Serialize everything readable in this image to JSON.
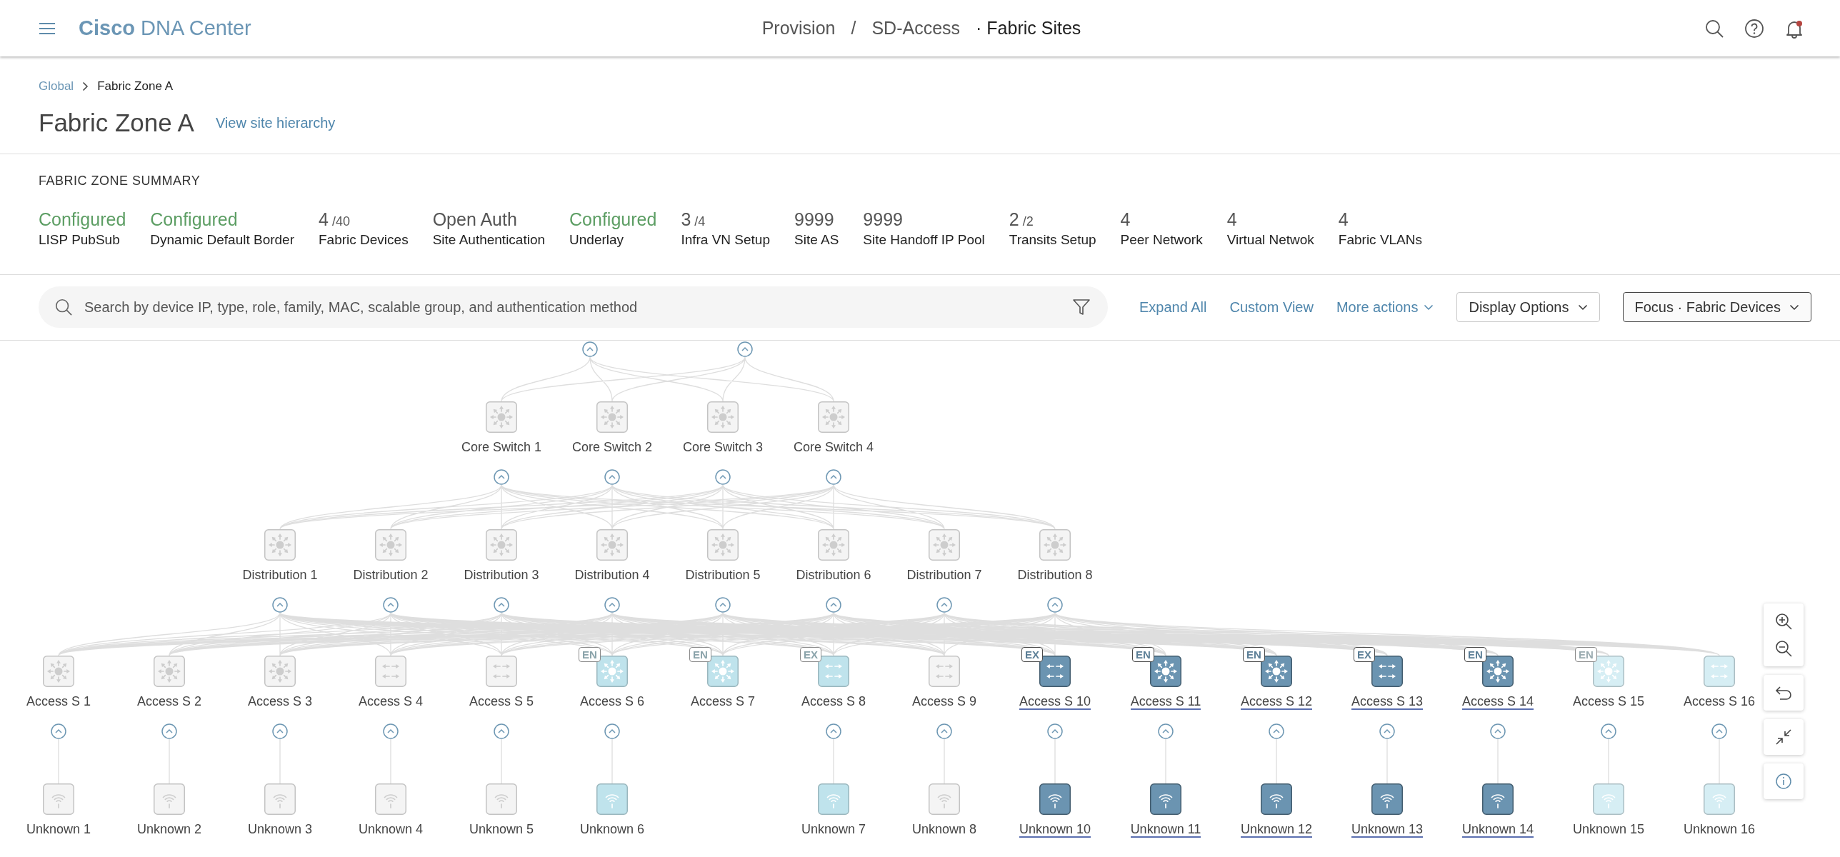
{
  "header": {
    "app_name": "**Cisco** DNA Center",
    "nav": [
      {
        "label": "Provision"
      },
      {
        "label": "SD-Access"
      }
    ],
    "nav_separator": "/",
    "current_page": "· Fabric Sites",
    "notification_dot": true
  },
  "breadcrumb": [
    {
      "label": "Global"
    },
    {
      "label": "Fabric Zone A"
    }
  ],
  "page_title": "Fabric Zone A",
  "hierarchy_link": "View site hierarchy",
  "summary": {
    "title": "FABRIC ZONE SUMMARY",
    "items": [
      {
        "kind": "status",
        "value": "Configured",
        "label": "LISP PubSub"
      },
      {
        "kind": "status",
        "value": "Configured",
        "label": "Dynamic Default Border"
      },
      {
        "kind": "count",
        "value": "4",
        "total": "/40",
        "label": "Fabric Devices"
      },
      {
        "kind": "count",
        "value": "Open Auth",
        "label": "Site Authentication"
      },
      {
        "kind": "status",
        "value": "Configured",
        "label": "Underlay"
      },
      {
        "kind": "count",
        "value": "3",
        "total": "/4",
        "label": "Infra VN Setup"
      },
      {
        "kind": "count",
        "value": "9999",
        "label": "Site AS"
      },
      {
        "kind": "count",
        "value": "9999",
        "label": "Site Handoff IP Pool"
      },
      {
        "kind": "count",
        "value": "2",
        "total": "/2",
        "label": "Transits Setup"
      },
      {
        "kind": "count",
        "value": "4",
        "label": "Peer Network"
      },
      {
        "kind": "count",
        "value": "4",
        "label": "Virtual Netwok"
      },
      {
        "kind": "count",
        "value": "4",
        "label": "Fabric VLANs"
      }
    ]
  },
  "toolbar": {
    "search_placeholder": "Search by device IP, type, role, family, MAC, scalable group, and authentication method",
    "links": [
      {
        "label": "Expand All",
        "dropdown": false
      },
      {
        "label": "Custom View",
        "dropdown": false
      },
      {
        "label": "More actions",
        "dropdown": true
      }
    ],
    "buttons": [
      {
        "label": "Display Options",
        "selected": false
      },
      {
        "label": "Focus · Fabric Devices",
        "selected": true
      }
    ]
  },
  "topology": {
    "upstream_toggles": [
      {
        "expanded": true
      },
      {
        "expanded": true
      }
    ],
    "tiers": [
      {
        "nodes": [
          {
            "label": "Core Switch 1",
            "kind": "multilayer",
            "color": "#f4f4f4",
            "selected": false,
            "expanded": true
          },
          {
            "label": "Core Switch 2",
            "kind": "multilayer",
            "color": "#f4f4f4",
            "selected": false,
            "expanded": true
          },
          {
            "label": "Core Switch 3",
            "kind": "multilayer",
            "color": "#f4f4f4",
            "selected": false,
            "expanded": true
          },
          {
            "label": "Core Switch 4",
            "kind": "multilayer",
            "color": "#f4f4f4",
            "selected": false,
            "expanded": true
          }
        ]
      },
      {
        "nodes": [
          {
            "label": "Distribution 1",
            "kind": "multilayer",
            "color": "#f4f4f4",
            "selected": false,
            "expanded": true
          },
          {
            "label": "Distribution 2",
            "kind": "multilayer",
            "color": "#f4f4f4",
            "selected": false,
            "expanded": true
          },
          {
            "label": "Distribution 3",
            "kind": "multilayer",
            "color": "#f4f4f4",
            "selected": false,
            "expanded": true
          },
          {
            "label": "Distribution 4",
            "kind": "multilayer",
            "color": "#f4f4f4",
            "selected": false,
            "expanded": true
          },
          {
            "label": "Distribution 5",
            "kind": "multilayer",
            "color": "#f4f4f4",
            "selected": false,
            "expanded": true
          },
          {
            "label": "Distribution 6",
            "kind": "multilayer",
            "color": "#f4f4f4",
            "selected": false,
            "expanded": true
          },
          {
            "label": "Distribution 7",
            "kind": "multilayer",
            "color": "#f4f4f4",
            "selected": false,
            "expanded": true
          },
          {
            "label": "Distribution 8",
            "kind": "multilayer",
            "color": "#f4f4f4",
            "selected": false,
            "expanded": true
          }
        ]
      },
      {
        "nodes": [
          {
            "label": "Access S 1",
            "kind": "multilayer",
            "color": "#f4f4f4",
            "selected": false,
            "expanded": true,
            "children": [
              {
                "label": "Unknown 1",
                "kind": "ap",
                "color": "#f4f4f4",
                "selected": false
              }
            ]
          },
          {
            "label": "Access S 2",
            "kind": "multilayer",
            "color": "#f4f4f4",
            "selected": false,
            "expanded": true,
            "children": [
              {
                "label": "Unknown 2",
                "kind": "ap",
                "color": "#f4f4f4",
                "selected": false
              }
            ]
          },
          {
            "label": "Access S 3",
            "kind": "multilayer",
            "color": "#f4f4f4",
            "selected": false,
            "expanded": true,
            "children": [
              {
                "label": "Unknown 3",
                "kind": "ap",
                "color": "#f4f4f4",
                "selected": false
              }
            ]
          },
          {
            "label": "Access S 4",
            "kind": "switch",
            "color": "#f4f4f4",
            "selected": false,
            "expanded": true,
            "children": [
              {
                "label": "Unknown 4",
                "kind": "ap",
                "color": "#f4f4f4",
                "selected": false
              }
            ]
          },
          {
            "label": "Access S 5",
            "kind": "switch",
            "color": "#f4f4f4",
            "selected": false,
            "expanded": true,
            "children": [
              {
                "label": "Unknown 5",
                "kind": "ap",
                "color": "#f4f4f4",
                "selected": false
              }
            ]
          },
          {
            "label": "Access S 6",
            "kind": "multilayer",
            "color": "#bfe3ec",
            "selected": false,
            "badge": "EN",
            "expanded": true,
            "children": [
              {
                "label": "Unknown 6",
                "kind": "ap",
                "color": "#bfe3ec",
                "selected": false
              }
            ]
          },
          {
            "label": "Access S 7",
            "kind": "multilayer",
            "color": "#bfe3ec",
            "selected": false,
            "badge": "EN"
          },
          {
            "label": "Access S 8",
            "kind": "switch",
            "color": "#bfe3ec",
            "selected": false,
            "badge": "EX",
            "expanded": true,
            "children": [
              {
                "label": "Unknown 7",
                "kind": "ap",
                "color": "#bfe3ec",
                "selected": false
              }
            ]
          },
          {
            "label": "Access S 9",
            "kind": "switch",
            "color": "#f4f4f4",
            "selected": false,
            "expanded": true,
            "children": [
              {
                "label": "Unknown 8",
                "kind": "ap",
                "color": "#f4f4f4",
                "selected": false
              }
            ]
          },
          {
            "label": "Access S 10",
            "kind": "switch",
            "color": "#6b94b1",
            "selected": true,
            "badge": "EX",
            "expanded": true,
            "children": [
              {
                "label": "Unknown 10",
                "kind": "ap",
                "color": "#6b94b1",
                "selected": true
              }
            ]
          },
          {
            "label": "Access S 11",
            "kind": "multilayer",
            "color": "#6b94b1",
            "selected": true,
            "badge": "EN",
            "expanded": true,
            "children": [
              {
                "label": "Unknown 11",
                "kind": "ap",
                "color": "#6b94b1",
                "selected": true
              }
            ]
          },
          {
            "label": "Access S 12",
            "kind": "multilayer",
            "color": "#6b94b1",
            "selected": true,
            "badge": "EN",
            "expanded": true,
            "children": [
              {
                "label": "Unknown 12",
                "kind": "ap",
                "color": "#6b94b1",
                "selected": true
              }
            ]
          },
          {
            "label": "Access S 13",
            "kind": "switch",
            "color": "#6b94b1",
            "selected": true,
            "badge": "EX",
            "expanded": true,
            "children": [
              {
                "label": "Unknown 13",
                "kind": "ap",
                "color": "#6b94b1",
                "selected": true
              }
            ]
          },
          {
            "label": "Access S 14",
            "kind": "multilayer",
            "color": "#6b94b1",
            "selected": true,
            "badge": "EN",
            "expanded": true,
            "children": [
              {
                "label": "Unknown 14",
                "kind": "ap",
                "color": "#6b94b1",
                "selected": true
              }
            ]
          },
          {
            "label": "Access S 15",
            "kind": "multilayer",
            "color": "#d6eef4",
            "selected": false,
            "badge": "EN",
            "expanded": true,
            "children": [
              {
                "label": "Unknown 15",
                "kind": "ap",
                "color": "#d6eef4",
                "selected": false
              }
            ]
          },
          {
            "label": "Access S 16",
            "kind": "switch",
            "color": "#d6eef4",
            "selected": false,
            "expanded": true,
            "children": [
              {
                "label": "Unknown 16",
                "kind": "ap",
                "color": "#d6eef4",
                "selected": false
              }
            ]
          }
        ]
      }
    ]
  }
}
